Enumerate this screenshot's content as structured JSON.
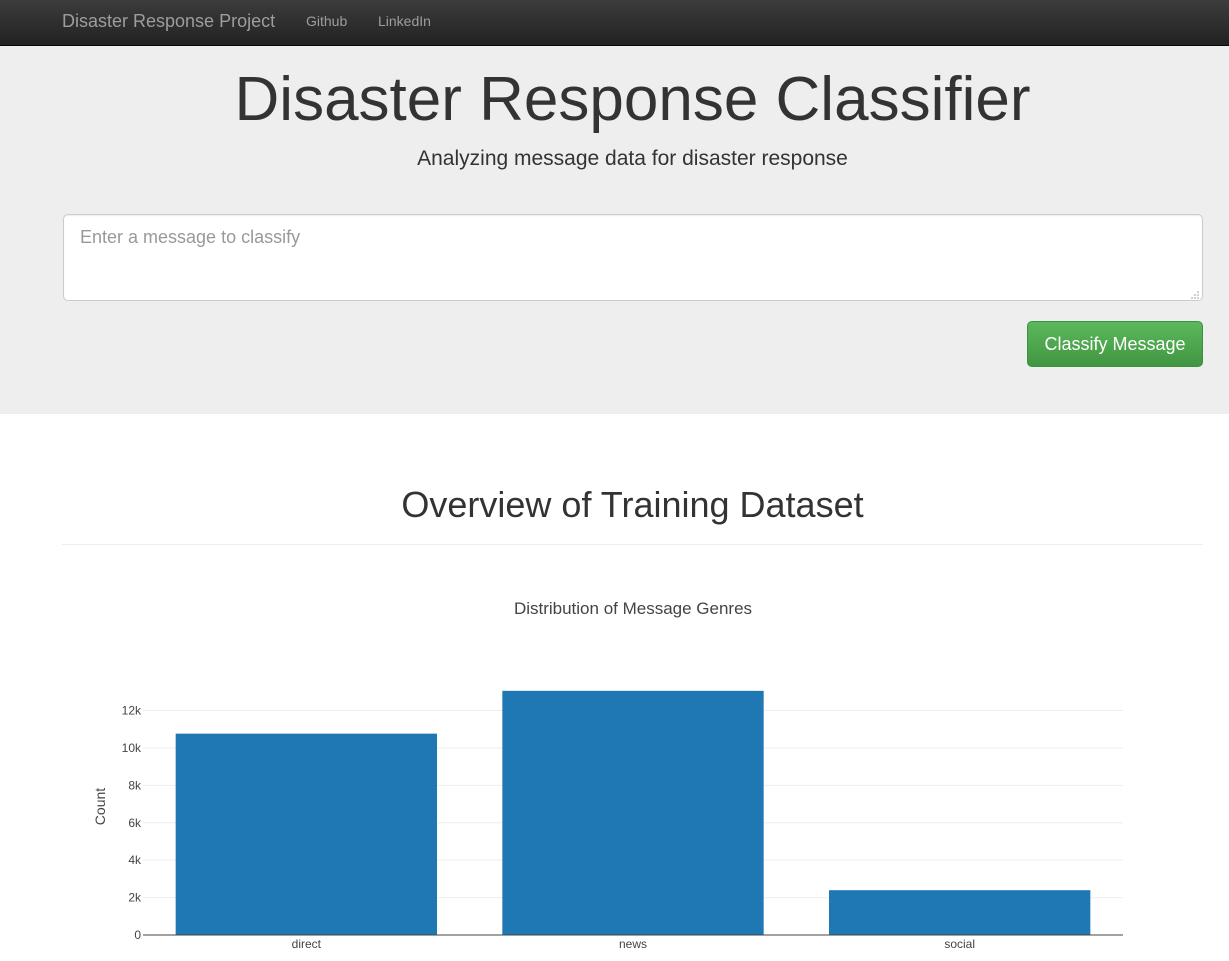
{
  "navbar": {
    "brand": "Disaster Response Project",
    "links": [
      "Github",
      "LinkedIn"
    ]
  },
  "jumbotron": {
    "title": "Disaster Response Classifier",
    "subtitle": "Analyzing message data for disaster response",
    "message_input": {
      "placeholder": "Enter a message to classify",
      "value": ""
    },
    "classify_button": "Classify Message"
  },
  "overview": {
    "heading": "Overview of Training Dataset"
  },
  "colors": {
    "navbar_bg": "#222222",
    "jumbotron_bg": "#eeeeee",
    "button_green": "#5cb85c",
    "bar_blue": "#1f77b4"
  },
  "chart_data": {
    "type": "bar",
    "title": "Distribution of Message Genres",
    "xlabel": "",
    "ylabel": "Count",
    "categories": [
      "direct",
      "news",
      "social"
    ],
    "values": [
      10766,
      13054,
      2396
    ],
    "ylim": [
      0,
      13741
    ],
    "yticks": [
      0,
      2000,
      4000,
      6000,
      8000,
      10000,
      12000
    ],
    "ytick_labels": [
      "0",
      "2k",
      "4k",
      "6k",
      "8k",
      "10k",
      "12k"
    ],
    "grid": true,
    "bar_color": "#1f77b4"
  }
}
